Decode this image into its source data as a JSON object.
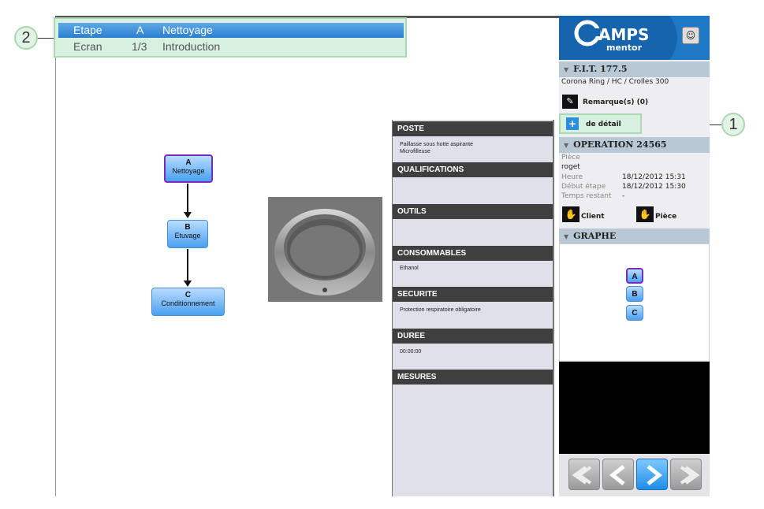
{
  "callouts": {
    "one": "1",
    "two": "2"
  },
  "header": {
    "row1": {
      "label": "Etape",
      "code": "A",
      "name": "Nettoyage"
    },
    "row2": {
      "label": "Ecran",
      "code": "1/3",
      "name": "Introduction"
    }
  },
  "flow": {
    "nodes": [
      {
        "letter": "A",
        "name": "Nettoyage"
      },
      {
        "letter": "B",
        "name": "Etuvage"
      },
      {
        "letter": "C",
        "name": "Conditionnement"
      }
    ]
  },
  "sections": [
    {
      "title": "POSTE",
      "value": "Paillasse sous hotte aspirante\nMicrofilleuse"
    },
    {
      "title": "QUALIFICATIONS",
      "value": ""
    },
    {
      "title": "OUTILS",
      "value": ""
    },
    {
      "title": "CONSOMMABLES",
      "value": "Ethanol"
    },
    {
      "title": "SECURITE",
      "value": "Protection respiratoire obligatoire"
    },
    {
      "title": "DUREE",
      "value": "00:00:00"
    },
    {
      "title": "MESURES",
      "value": ""
    }
  ],
  "sidebar": {
    "logo_main": "AMPS",
    "logo_sub": "mentor",
    "fit_title": "F.I.T. 177.5",
    "fit_subtitle": "Corona Ring / HC / Crolles 300",
    "remarks_label": "Remarque(s) (0)",
    "detail_label": "de détail",
    "operation_title": "OPERATION 24565",
    "piece_label": "Pièce",
    "piece_value": "roget",
    "heure_label": "Heure",
    "heure_value": "18/12/2012 15:31",
    "debut_label": "Début étape",
    "debut_value": "18/12/2012 15:30",
    "temps_label": "Temps restant",
    "temps_value": "-",
    "client_label": "Client",
    "piece_button_label": "Pièce",
    "graphe_title": "GRAPHE",
    "graph_nodes": [
      "A",
      "B",
      "C"
    ]
  },
  "colors": {
    "accent": "#2b7fd0",
    "highlight": "#d7f0df",
    "active_node_border": "#7a2bbf"
  },
  "icons": [
    "pencil-icon",
    "plus-icon",
    "hand-icon",
    "chevron-down-icon",
    "arrow-left-icon",
    "arrow-right-icon"
  ]
}
